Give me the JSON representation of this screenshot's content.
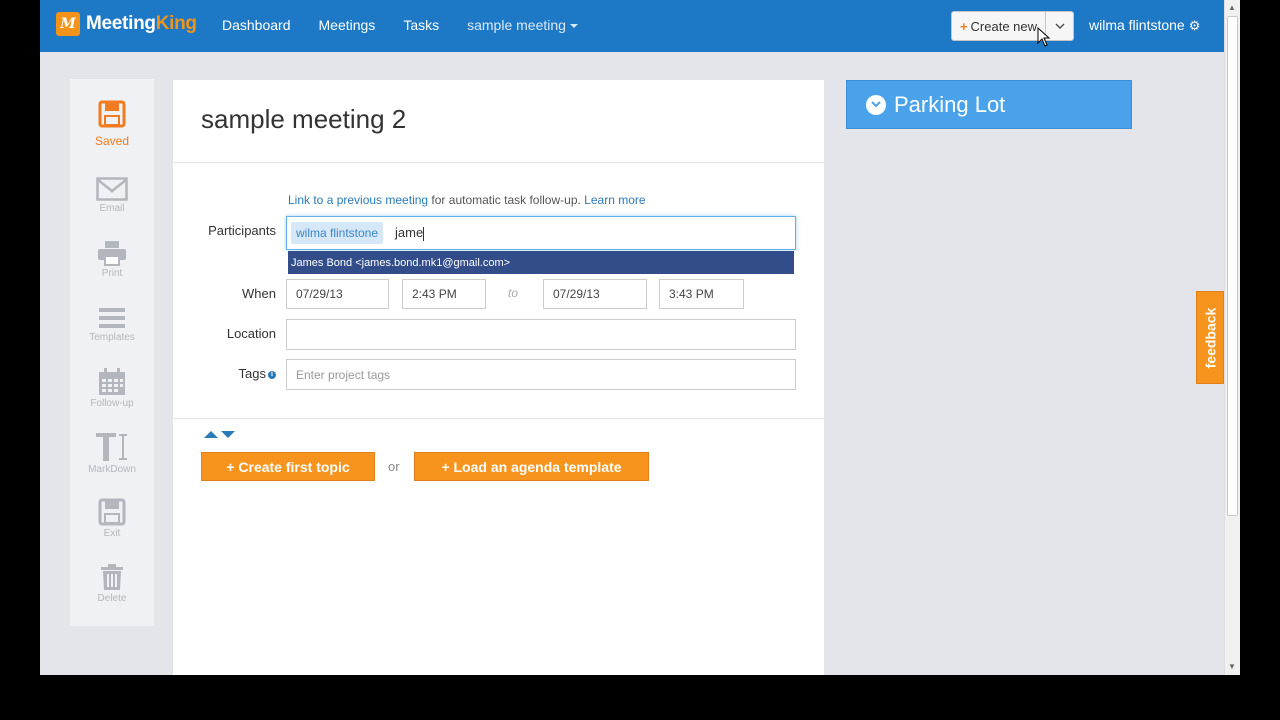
{
  "brand": {
    "meeting": "Meeting",
    "king": "King",
    "mark": "M"
  },
  "nav": {
    "items": [
      "Dashboard",
      "Meetings",
      "Tasks"
    ],
    "current_meeting": "sample meeting"
  },
  "toolbar": {
    "create_label": "Create new",
    "plus": "+",
    "user": "wilma flintstone"
  },
  "sidebar": {
    "items": [
      {
        "label": "Saved",
        "icon": "save-icon"
      },
      {
        "label": "Email",
        "icon": "email-icon"
      },
      {
        "label": "Print",
        "icon": "print-icon"
      },
      {
        "label": "Templates",
        "icon": "templates-icon"
      },
      {
        "label": "Follow-up",
        "icon": "calendar-icon"
      },
      {
        "label": "MarkDown",
        "icon": "markdown-icon"
      },
      {
        "label": "Exit",
        "icon": "exit-icon"
      },
      {
        "label": "Delete",
        "icon": "trash-icon"
      }
    ]
  },
  "meeting": {
    "title": "sample meeting 2",
    "hint": {
      "link1": "Link to a previous meeting",
      "middle": " for automatic task follow-up. ",
      "link2": "Learn more"
    },
    "participants": {
      "label": "Participants",
      "chip": "wilma flintstone",
      "typed": "jame",
      "suggestion": "James Bond <james.bond.mk1@gmail.com>"
    },
    "when": {
      "label": "When",
      "start_date": "07/29/13",
      "start_time": "2:43 PM",
      "to": "to",
      "end_date": "07/29/13",
      "end_time": "3:43 PM"
    },
    "location": {
      "label": "Location",
      "value": ""
    },
    "tags": {
      "label": "Tags",
      "placeholder": "Enter project tags",
      "info": "i"
    },
    "actions": {
      "create_topic": "+ Create first topic",
      "or": "or",
      "load_template": "+ Load an agenda template"
    }
  },
  "parking_lot": {
    "title": "Parking Lot"
  },
  "feedback": {
    "label": "feedback"
  },
  "colors": {
    "nav": "#1d79c5",
    "accent": "#f7941d",
    "parking": "#4aa3ea",
    "suggest": "#324d8a"
  }
}
